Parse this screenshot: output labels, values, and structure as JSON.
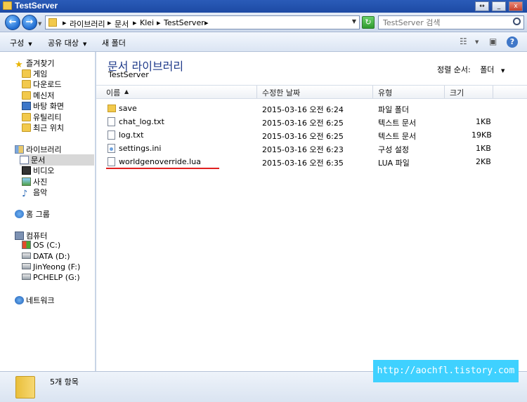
{
  "window": {
    "title": "TestServer",
    "controls": [
      "↔",
      "_",
      "□",
      "x"
    ]
  },
  "address": {
    "crumbs": [
      "라이브러리",
      "문서",
      "Klei",
      "TestServer"
    ],
    "search_placeholder": "TestServer 검색"
  },
  "toolbar": {
    "organize": "구성",
    "share": "공유 대상",
    "new_folder": "새 폴더"
  },
  "nav": {
    "favorites": "즐겨찾기",
    "favorites_items": [
      "게임",
      "다운로드",
      "메신저",
      "바탕 화면",
      "유틸리티",
      "최근 위치"
    ],
    "libraries": "라이브러리",
    "library_items": [
      "문서",
      "비디오",
      "사진",
      "음악"
    ],
    "homegroup": "홈 그룹",
    "computer": "컴퓨터",
    "drives": [
      "OS (C:)",
      "DATA (D:)",
      "JinYeong (F:)",
      "PCHELP (G:)"
    ],
    "network": "네트워크"
  },
  "content": {
    "library_title": "문서 라이브러리",
    "library_subtitle": "TestServer",
    "arrange_label": "정렬 순서:",
    "arrange_value": "폴더",
    "columns": {
      "name": "이름",
      "modified": "수정한 날짜",
      "type": "유형",
      "size": "크기"
    },
    "files": [
      {
        "name": "save",
        "modified": "2015-03-16 오전 6:24",
        "type": "파일 폴더",
        "size": "",
        "icon": "folder-icon"
      },
      {
        "name": "chat_log.txt",
        "modified": "2015-03-16 오전 6:25",
        "type": "텍스트 문서",
        "size": "1KB",
        "icon": "text-file-icon"
      },
      {
        "name": "log.txt",
        "modified": "2015-03-16 오전 6:25",
        "type": "텍스트 문서",
        "size": "19KB",
        "icon": "text-file-icon"
      },
      {
        "name": "settings.ini",
        "modified": "2015-03-16 오전 6:23",
        "type": "구성 설정",
        "size": "1KB",
        "icon": "settings-file-icon"
      },
      {
        "name": "worldgenoverride.lua",
        "modified": "2015-03-16 오전 6:35",
        "type": "LUA 파일",
        "size": "2KB",
        "icon": "text-file-icon"
      }
    ],
    "highlight_color": "#e02020"
  },
  "status": {
    "item_count": "5개 항목"
  },
  "watermark": "http://aochfl.tistory.com"
}
